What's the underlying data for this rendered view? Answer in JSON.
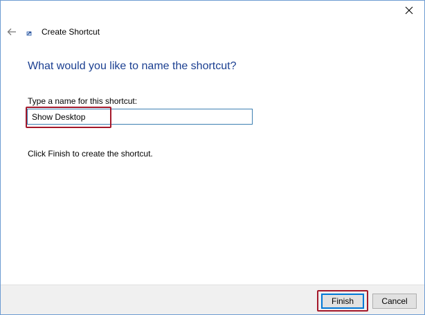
{
  "window": {
    "title": "Create Shortcut",
    "close_icon": "close-icon",
    "back_icon": "back-arrow-icon",
    "shortcut_icon": "shortcut-icon"
  },
  "main": {
    "heading": "What would you like to name the shortcut?",
    "field_label": "Type a name for this shortcut:",
    "name_value": "Show Desktop",
    "hint": "Click Finish to create the shortcut."
  },
  "footer": {
    "finish_label": "Finish",
    "cancel_label": "Cancel"
  },
  "colors": {
    "heading": "#1b3f91",
    "highlight": "#a4182a",
    "input_border": "#3c7fb1",
    "focus_border": "#0078d7"
  }
}
